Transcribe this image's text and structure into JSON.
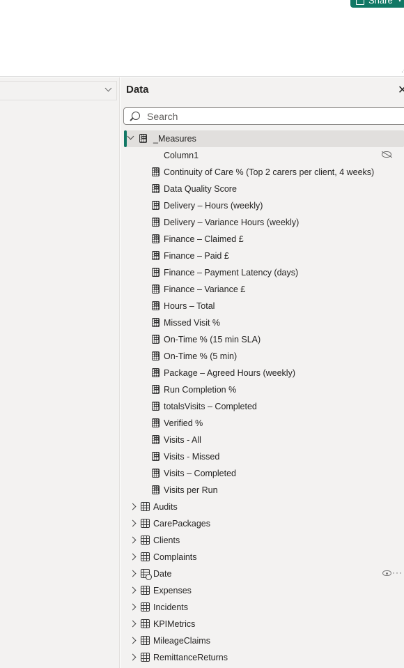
{
  "header": {
    "share_label": "Share"
  },
  "data_pane": {
    "title": "Data",
    "close_glyph": "✕",
    "search": {
      "placeholder": "Search",
      "value": ""
    },
    "measures_table": {
      "name": "_Measures",
      "expanded": true,
      "items": [
        {
          "label": "Column1",
          "icon": "none",
          "hidden": true
        },
        {
          "label": "Continuity of Care % (Top 2 carers per client, 4 weeks)",
          "icon": "calculator-icon"
        },
        {
          "label": "Data Quality Score",
          "icon": "calculator-icon"
        },
        {
          "label": "Delivery – Hours (weekly)",
          "icon": "calculator-icon"
        },
        {
          "label": "Delivery – Variance Hours (weekly)",
          "icon": "calculator-icon"
        },
        {
          "label": "Finance – Claimed £",
          "icon": "calculator-icon"
        },
        {
          "label": "Finance – Paid £",
          "icon": "calculator-icon"
        },
        {
          "label": "Finance – Payment Latency (days)",
          "icon": "calculator-icon"
        },
        {
          "label": "Finance – Variance £",
          "icon": "calculator-icon"
        },
        {
          "label": "Hours – Total",
          "icon": "calculator-icon"
        },
        {
          "label": "Missed Visit %",
          "icon": "calculator-icon"
        },
        {
          "label": "On-Time % (15 min SLA)",
          "icon": "calculator-icon"
        },
        {
          "label": "On-Time % (5 min)",
          "icon": "calculator-icon"
        },
        {
          "label": "Package – Agreed Hours (weekly)",
          "icon": "calculator-icon"
        },
        {
          "label": "Run Completion %",
          "icon": "calculator-icon"
        },
        {
          "label": "totalsVisits – Completed",
          "icon": "calculator-icon"
        },
        {
          "label": "Verified %",
          "icon": "calculator-icon"
        },
        {
          "label": "Visits - All",
          "icon": "calculator-icon"
        },
        {
          "label": "Visits - Missed",
          "icon": "calculator-icon"
        },
        {
          "label": "Visits – Completed",
          "icon": "calculator-icon"
        },
        {
          "label": "Visits per Run",
          "icon": "calculator-icon"
        }
      ]
    },
    "tables": [
      {
        "name": "Audits",
        "icon": "table-icon"
      },
      {
        "name": "CarePackages",
        "icon": "table-icon"
      },
      {
        "name": "Clients",
        "icon": "table-icon"
      },
      {
        "name": "Complaints",
        "icon": "table-icon"
      },
      {
        "name": "Date",
        "icon": "date-table-icon",
        "hovered": true
      },
      {
        "name": "Expenses",
        "icon": "table-icon"
      },
      {
        "name": "Incidents",
        "icon": "table-icon"
      },
      {
        "name": "KPIMetrics",
        "icon": "table-icon"
      },
      {
        "name": "MileageClaims",
        "icon": "table-icon"
      },
      {
        "name": "RemittanceReturns",
        "icon": "table-icon"
      }
    ]
  }
}
